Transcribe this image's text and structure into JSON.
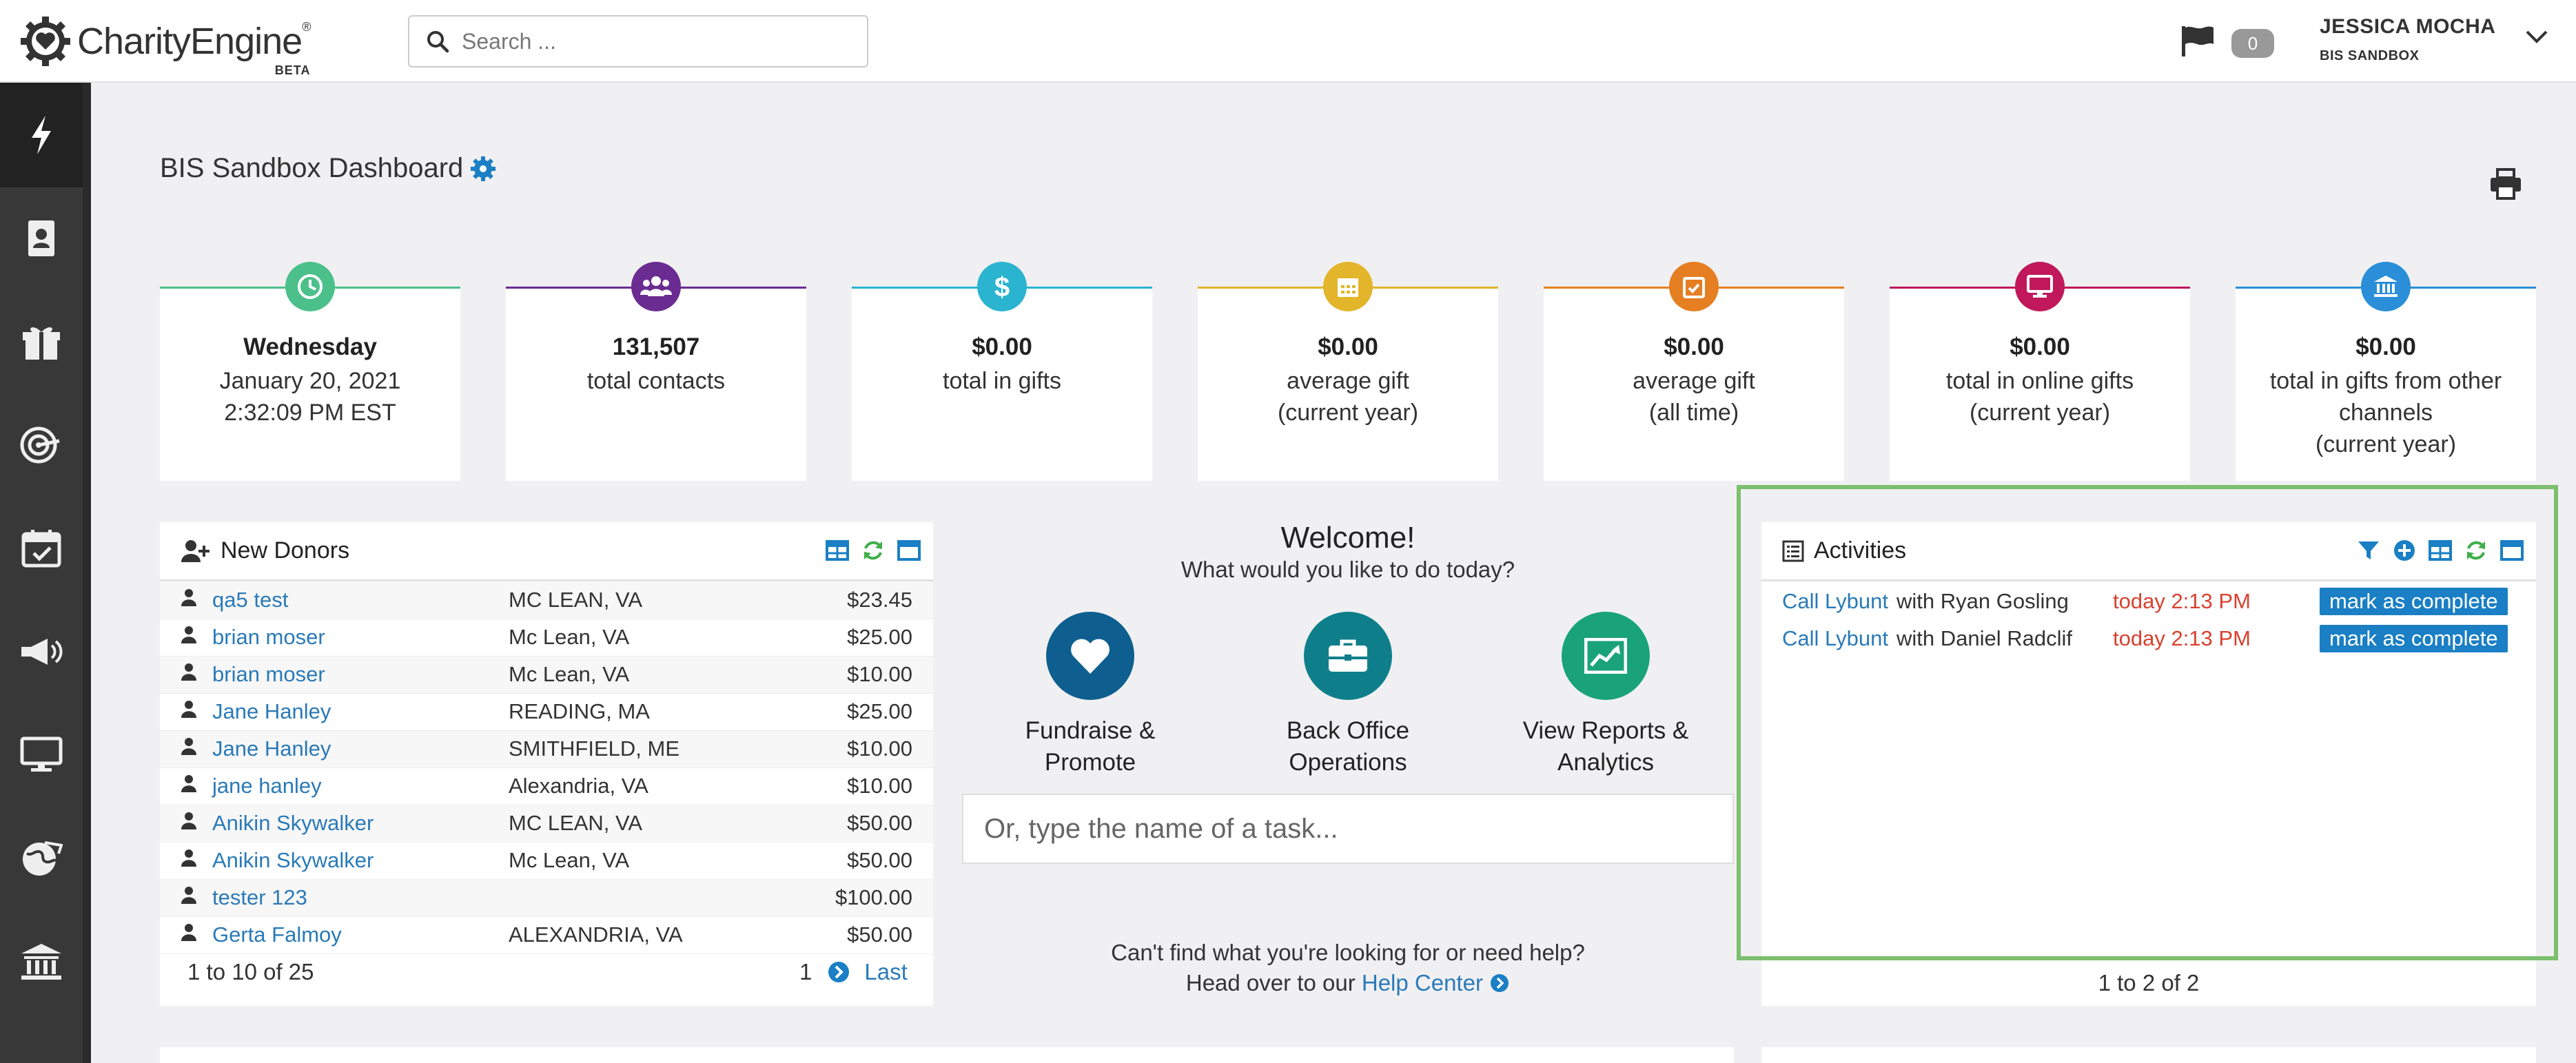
{
  "app": {
    "name": "CharityEngine",
    "reg": "®",
    "beta": "BETA"
  },
  "search": {
    "placeholder": "Search ..."
  },
  "notifications": {
    "count": "0"
  },
  "user": {
    "name": "JESSICA MOCHA",
    "org": "BIS SANDBOX"
  },
  "sidebar": {
    "items": [
      {
        "icon": "lightning-icon"
      },
      {
        "icon": "contacts-book-icon"
      },
      {
        "icon": "gift-icon"
      },
      {
        "icon": "target-icon"
      },
      {
        "icon": "calendar-icon"
      },
      {
        "icon": "megaphone-icon"
      },
      {
        "icon": "monitor-icon"
      },
      {
        "icon": "globe-icon"
      },
      {
        "icon": "bank-icon"
      }
    ]
  },
  "page": {
    "title": "BIS Sandbox Dashboard"
  },
  "stats": [
    {
      "icon": "clock-icon",
      "color": "#4cc08a",
      "value": "Wednesday",
      "line1": "January 20, 2021",
      "line2": "2:32:09 PM EST"
    },
    {
      "icon": "users-icon",
      "color": "#6a2c91",
      "value": "131,507",
      "line1": "total contacts",
      "line2": ""
    },
    {
      "icon": "dollar-icon",
      "color": "#2ab4cf",
      "value": "$0.00",
      "line1": "total in gifts",
      "line2": ""
    },
    {
      "icon": "calendar-grid-icon",
      "color": "#e2b52a",
      "value": "$0.00",
      "line1": "average gift",
      "line2": "(current year)"
    },
    {
      "icon": "calendar-check-icon",
      "color": "#e67e22",
      "value": "$0.00",
      "line1": "average gift",
      "line2": "(all time)"
    },
    {
      "icon": "monitor-icon",
      "color": "#c0185b",
      "value": "$0.00",
      "line1": "total in online gifts",
      "line2": "(current year)"
    },
    {
      "icon": "bank-icon",
      "color": "#2a8fd8",
      "value": "$0.00",
      "line1": "total in gifts from other",
      "line2": "channels",
      "line3": "(current year)"
    }
  ],
  "new_donors": {
    "title": "New Donors",
    "rows": [
      {
        "name": "qa5 test",
        "location": "MC LEAN, VA",
        "amount": "$23.45"
      },
      {
        "name": "brian moser",
        "location": "Mc Lean, VA",
        "amount": "$25.00"
      },
      {
        "name": "brian moser",
        "location": "Mc Lean, VA",
        "amount": "$10.00"
      },
      {
        "name": "Jane Hanley",
        "location": "READING, MA",
        "amount": "$25.00"
      },
      {
        "name": "Jane Hanley",
        "location": "SMITHFIELD, ME",
        "amount": "$10.00"
      },
      {
        "name": "jane hanley",
        "location": "Alexandria, VA",
        "amount": "$10.00"
      },
      {
        "name": "Anikin Skywalker",
        "location": "MC LEAN, VA",
        "amount": "$50.00"
      },
      {
        "name": "Anikin Skywalker",
        "location": "Mc Lean, VA",
        "amount": "$50.00"
      },
      {
        "name": "tester 123",
        "location": "",
        "amount": "$100.00"
      },
      {
        "name": "Gerta Falmoy",
        "location": "ALEXANDRIA, VA",
        "amount": "$50.00"
      }
    ],
    "footer": "1 to 10 of 25",
    "page_number": "1",
    "last_label": "Last"
  },
  "welcome": {
    "title": "Welcome!",
    "subtitle": "What would you like to do today?",
    "actions": [
      {
        "line1": "Fundraise &",
        "line2": "Promote",
        "color": "#0e5f8f",
        "icon": "heart-icon"
      },
      {
        "line1": "Back Office",
        "line2": "Operations",
        "color": "#0e7f8a",
        "icon": "briefcase-icon"
      },
      {
        "line1": "View Reports &",
        "line2": "Analytics",
        "color": "#1aa37a",
        "icon": "chart-icon"
      }
    ],
    "task_placeholder": "Or, type the name of a task...",
    "help_line1": "Can't find what you're looking for or need help?",
    "help_line2_prefix": "Head over to our",
    "help_link": "Help Center"
  },
  "activities": {
    "title": "Activities",
    "rows": [
      {
        "link": "Call Lybunt",
        "with": "with Ryan Gosling",
        "time": "today 2:13 PM",
        "button": "mark as complete"
      },
      {
        "link": "Call Lybunt",
        "with": "with Daniel Radclif",
        "time": "today 2:13 PM",
        "button": "mark as complete"
      }
    ],
    "footer": "1 to 2 of 2"
  }
}
